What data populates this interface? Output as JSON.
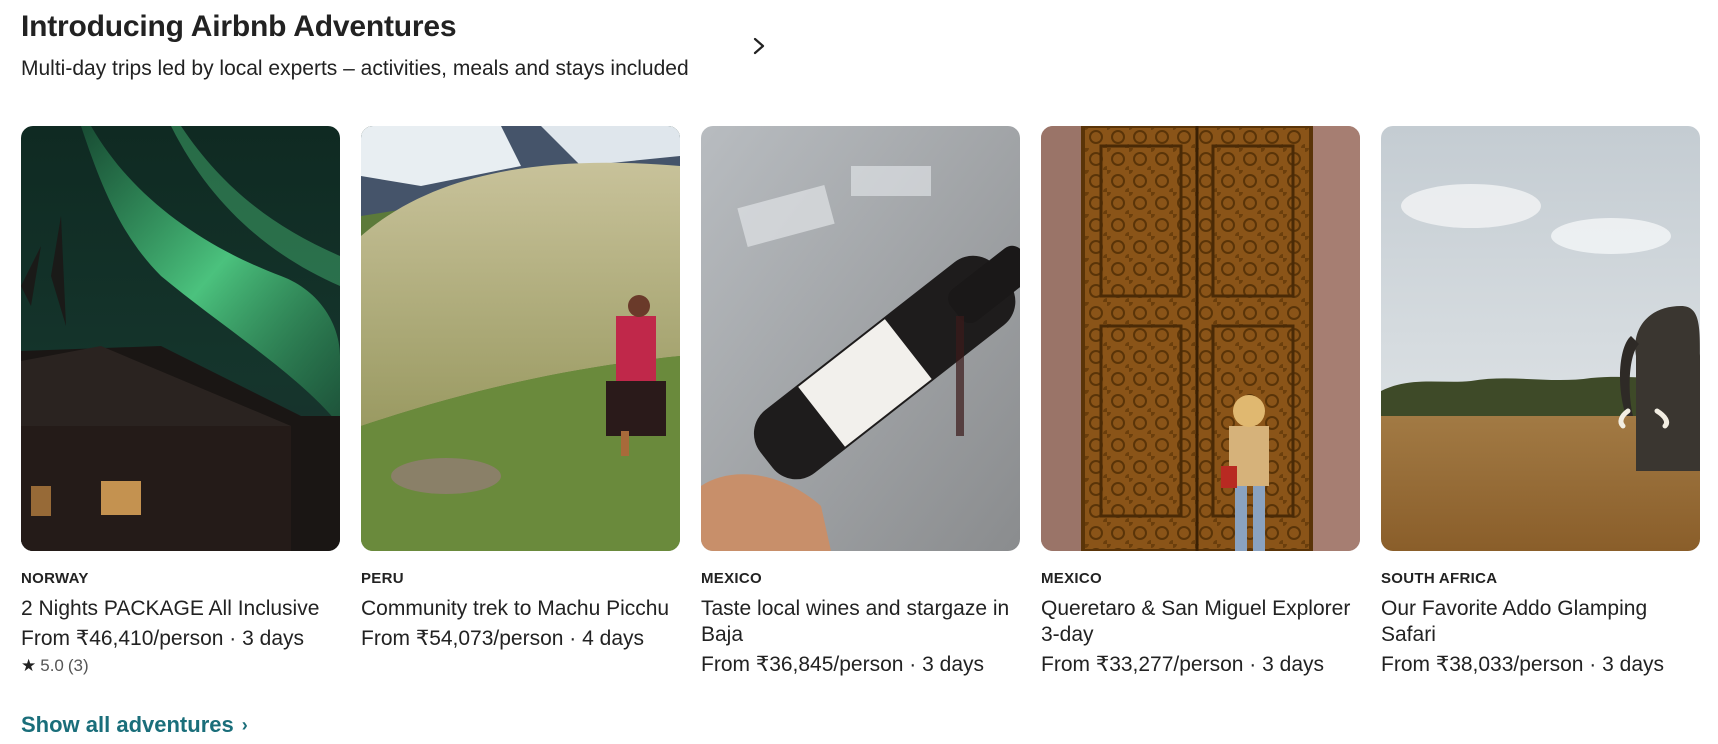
{
  "section": {
    "title": "Introducing Airbnb Adventures",
    "subtitle": "Multi-day trips led by local experts – activities, meals and stays included",
    "next_icon": "chevron-right-icon"
  },
  "cards": [
    {
      "country": "NORWAY",
      "title": "2 Nights PACKAGE All Inclusive",
      "price": "From ₹46,410/person · 3 days",
      "rating": "5.0",
      "reviews": "(3)",
      "image": "northern-lights-cabin"
    },
    {
      "country": "PERU",
      "title": "Community trek to Machu Picchu",
      "price": "From ₹54,073/person · 4 days",
      "image": "andes-trekker"
    },
    {
      "country": "MEXICO",
      "title": "Taste local wines and stargaze in Baja",
      "price": "From ₹36,845/person · 3 days",
      "image": "wine-bottle"
    },
    {
      "country": "MEXICO",
      "title": "Queretaro & San Miguel Explorer 3-day",
      "price": "From ₹33,277/person · 3 days",
      "image": "carved-wooden-door"
    },
    {
      "country": "SOUTH AFRICA",
      "title": "Our Favorite Addo Glamping Safari",
      "price": "From ₹38,033/person · 3 days",
      "image": "elephant-savanna"
    }
  ],
  "footer": {
    "show_all_label": "Show all adventures",
    "show_all_icon": "chevron-right-icon"
  },
  "colors": {
    "link": "#1a6e7a",
    "text": "#222222"
  }
}
